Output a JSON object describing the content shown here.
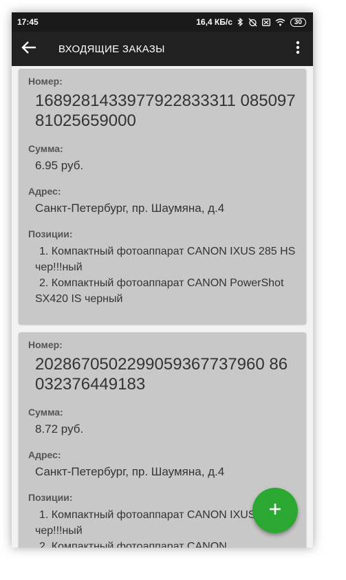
{
  "status_bar": {
    "time": "17:45",
    "network_speed": "16,4 КБ/с",
    "battery": "30",
    "icons": [
      "bluetooth-icon",
      "alarm-off-icon",
      "sim-off-icon",
      "wifi-icon",
      "battery-icon"
    ]
  },
  "app_bar": {
    "title": "ВХОДЯЩИЕ ЗАКАЗЫ",
    "back_icon": "arrow-back-icon",
    "menu_icon": "more-vertical-icon"
  },
  "labels": {
    "number": "Номер:",
    "sum": "Сумма:",
    "address": "Адрес:",
    "positions": "Позиции:"
  },
  "orders": [
    {
      "number": "1689281433977922833311 08509781025659000",
      "sum": "6.95 руб.",
      "address": "Санкт-Петербург, пр. Шаумяна, д.4",
      "positions": [
        {
          "index": "1.",
          "text": "Компактный фотоаппарат CANON IXUS 285 HS чер!!!ный"
        },
        {
          "index": "2.",
          "text": "Компактный фотоаппарат CANON PowerShot SX420 IS черный"
        }
      ]
    },
    {
      "number": "2028670502299059367737960 86032376449183",
      "sum": "8.72 руб.",
      "address": "Санкт-Петербург, пр. Шаумяна, д.4",
      "positions": [
        {
          "index": "1.",
          "text": "Компактный фотоаппарат CANON IXUS 285 HS чер!!!ный"
        },
        {
          "index": "2.",
          "text": "Компактный фотоаппарат CANON"
        }
      ]
    }
  ],
  "fab": {
    "icon": "plus-icon",
    "label": "+"
  },
  "colors": {
    "status_bar": "#1a1a1a",
    "app_bar": "#212121",
    "card": "#c8c8c8",
    "fab": "#2aa832"
  }
}
